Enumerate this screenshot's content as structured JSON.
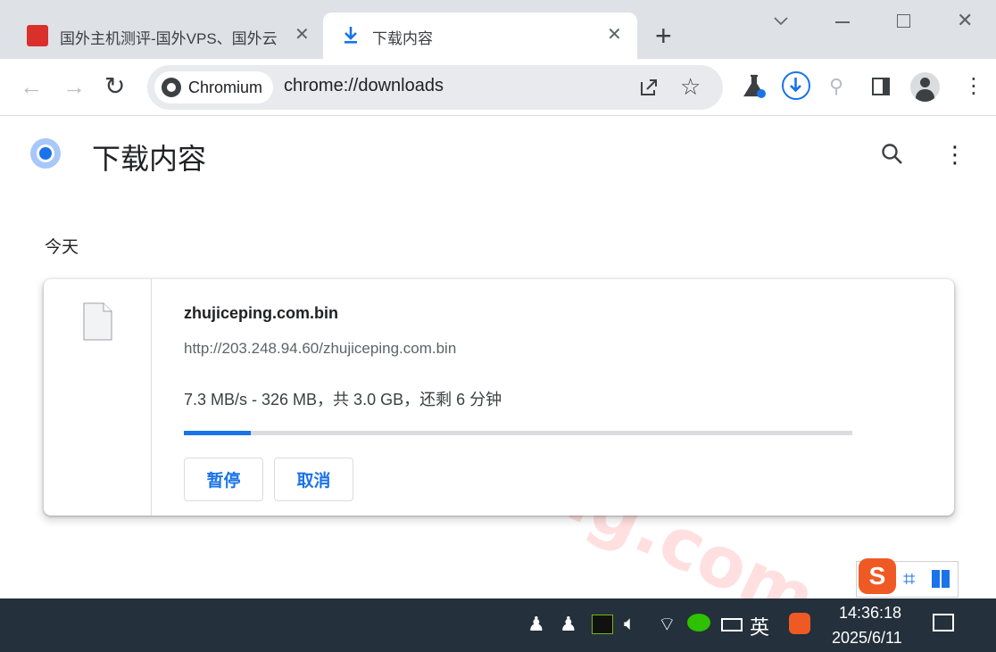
{
  "browser": {
    "tabs": [
      {
        "title": "国外主机测评-国外VPS、国外云",
        "icon": "site-favicon"
      },
      {
        "title": "下载内容",
        "icon": "download-icon"
      }
    ],
    "new_tab": "+",
    "window_controls": [
      "chevron-down-icon",
      "minimize-icon",
      "maximize-icon",
      "close-icon"
    ],
    "omnibox": {
      "chip": "Chromium",
      "url": "chrome://downloads"
    },
    "accent": "#1a73e8"
  },
  "page": {
    "title": "下载内容",
    "section": "今天",
    "download": {
      "file_name": "zhujiceping.com.bin",
      "source_url": "http://203.248.94.60/zhujiceping.com.bin",
      "status": "7.3 MB/s - 326 MB，共 3.0 GB，还剩 6 分钟",
      "progress": 0.1,
      "pause_label": "暂停",
      "cancel_label": "取消"
    },
    "watermark": "zhujiceping.com"
  },
  "taskbar": {
    "time": "14:36:18",
    "date": "2025/6/11",
    "ime_lang": "英"
  }
}
